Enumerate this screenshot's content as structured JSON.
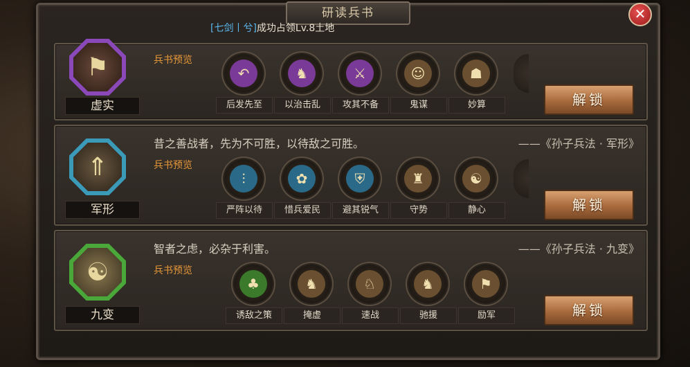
{
  "dialog": {
    "title": "研读兵书",
    "close_glyph": "✕",
    "condition": {
      "open": "[",
      "hero1": "七剑",
      "sep": "丨",
      "hero2": "兮",
      "close": "]",
      "text": "成功占领Lv.8土地"
    }
  },
  "books": [
    {
      "name": "虚实",
      "emblem_icon": "banner-icon",
      "emblem_color": "#8a48b8",
      "quote": "",
      "source": "",
      "preview_label": "兵书预览",
      "skills": [
        {
          "label": "后发先至",
          "icon": "arrow-arc-icon",
          "color": "#7a3a98"
        },
        {
          "label": "以治击乱",
          "icon": "soldier-icon",
          "color": "#7a3a98"
        },
        {
          "label": "攻其不备",
          "icon": "warrior-icon",
          "color": "#7a3a98"
        },
        {
          "label": "鬼谋",
          "icon": "strategist-icon",
          "color": "#6a5030"
        },
        {
          "label": "妙算",
          "icon": "helmet-icon",
          "color": "#6a5030"
        }
      ],
      "unlock_label": "解锁"
    },
    {
      "name": "军形",
      "emblem_icon": "formation-icon",
      "emblem_color": "#3a9ab8",
      "quote": "昔之善战者，先为不可胜，以待敌之可胜。",
      "source": "——《孙子兵法 · 军形》",
      "preview_label": "兵书预览",
      "skills": [
        {
          "label": "严阵以待",
          "icon": "spears-icon",
          "color": "#2a6a88"
        },
        {
          "label": "惜兵爱民",
          "icon": "plant-icon",
          "color": "#2a6a88"
        },
        {
          "label": "避其锐气",
          "icon": "shield-icon",
          "color": "#2a6a88"
        },
        {
          "label": "守势",
          "icon": "fortress-icon",
          "color": "#6a5030"
        },
        {
          "label": "静心",
          "icon": "meditate-icon",
          "color": "#6a5030"
        }
      ],
      "unlock_label": "解锁"
    },
    {
      "name": "九变",
      "emblem_icon": "yin-yang-icon",
      "emblem_color": "#4aa83a",
      "quote": "智者之虑，必杂于利害。",
      "source": "——《孙子兵法 · 九变》",
      "preview_label": "兵书预览",
      "skills": [
        {
          "label": "诱敌之策",
          "icon": "grass-icon",
          "color": "#3a7a2a"
        },
        {
          "label": "掩虚",
          "icon": "cavalry-icon",
          "color": "#6a5030"
        },
        {
          "label": "速战",
          "icon": "charge-icon",
          "color": "#6a5030"
        },
        {
          "label": "驰援",
          "icon": "rider-icon",
          "color": "#6a5030"
        },
        {
          "label": "励军",
          "icon": "flag-icon",
          "color": "#6a5030"
        }
      ],
      "unlock_label": "解锁"
    }
  ]
}
